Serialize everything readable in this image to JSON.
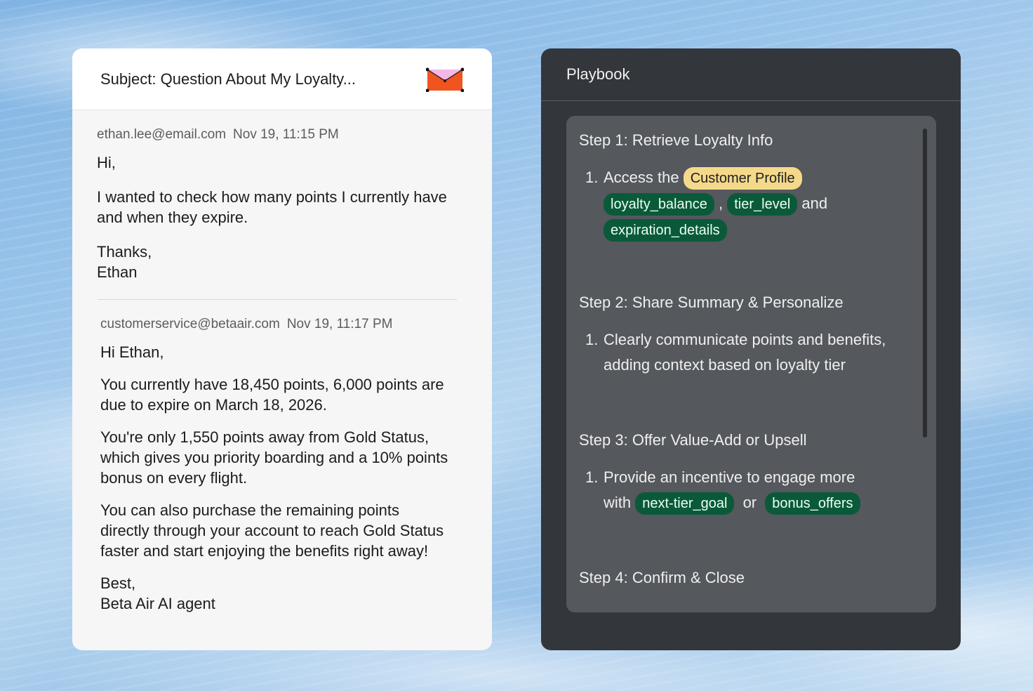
{
  "email": {
    "subject": "Subject: Question About My Loyalty...",
    "icon": "envelope-icon",
    "messages": [
      {
        "sender": "ethan.lee@email.com",
        "time": "Nov 19, 11:15 PM",
        "greeting": "Hi,",
        "paragraphs": [
          "I wanted to check how many points I currently have and when they expire."
        ],
        "signoff": "Thanks,",
        "signature": "Ethan"
      },
      {
        "sender": "customerservice@betaair.com",
        "time": "Nov 19, 11:17 PM",
        "greeting": "Hi Ethan,",
        "paragraphs": [
          "You currently have 18,450 points, 6,000 points are due to expire on March 18, 2026.",
          "You're only 1,550 points away from Gold Status, which gives you priority boarding and a 10% points bonus on every flight.",
          "You can also purchase the remaining points directly through your account to reach Gold Status faster and start enjoying the benefits right away!"
        ],
        "signoff": "Best,",
        "signature": "Beta Air AI agent"
      }
    ]
  },
  "playbook": {
    "title": "Playbook",
    "steps": [
      {
        "title": "Step 1: Retrieve Loyalty Info",
        "item_number": "1.",
        "item_text": "Access the",
        "highlight": "Customer Profile",
        "chips": [
          "loyalty_balance",
          "tier_level",
          "expiration_details"
        ],
        "separator": ",",
        "connector": "and"
      },
      {
        "title": "Step 2: Share Summary & Personalize",
        "item_number": "1.",
        "item_text": "Clearly communicate points and benefits, adding context based on loyalty tier"
      },
      {
        "title": "Step 3: Offer Value-Add or Upsell",
        "item_number": "1.",
        "item_text": "Provide an incentive to engage more",
        "item_text2": "with",
        "chips": [
          "next-tier_goal",
          "bonus_offers"
        ],
        "connector": "or"
      },
      {
        "title": "Step 4: Confirm & Close"
      }
    ]
  },
  "colors": {
    "chip_green": "#0a5a3a",
    "chip_yellow": "#f5d98a",
    "envelope_orange": "#f0541f",
    "envelope_flap": "#f4b7e6",
    "panel_dark": "#33363b"
  }
}
